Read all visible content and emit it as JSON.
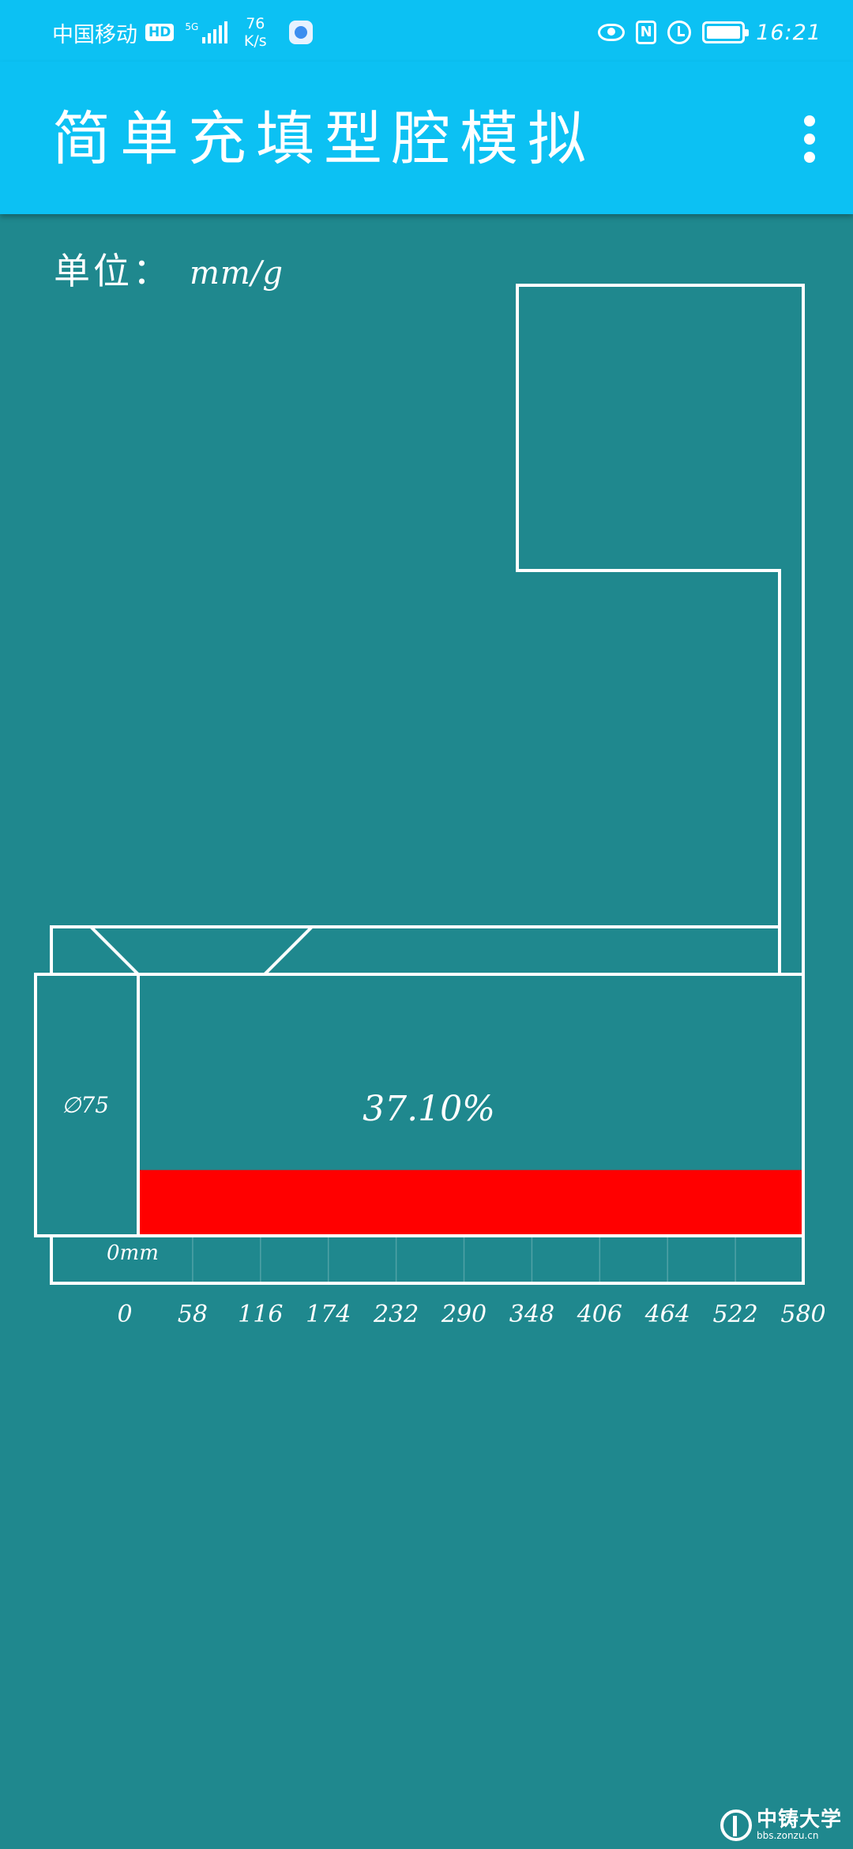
{
  "status_bar": {
    "carrier": "中国移动",
    "hd_badge": "HD",
    "network_type": "5G",
    "net_speed_value": "76",
    "net_speed_unit": "K/s",
    "time": "16:21",
    "nfc_label": "N",
    "icons": [
      "hd-icon",
      "signal-icon",
      "app-notification-icon",
      "eye-icon",
      "nfc-icon",
      "alarm-icon",
      "battery-icon"
    ]
  },
  "app_bar": {
    "title": "简单充填型腔模拟",
    "menu_icon": "overflow-menu-icon"
  },
  "unit": {
    "label": "单位：",
    "value": "mm/g"
  },
  "simulation": {
    "fill_percent_text": "37.10%",
    "fill_fraction": 0.371,
    "diameter_label": "∅75",
    "origin_label": "0mm",
    "scale_ticks": [
      "0",
      "58",
      "116",
      "174",
      "232",
      "290",
      "348",
      "406",
      "464",
      "522",
      "580"
    ],
    "fill_color": "#ff0000",
    "outline_color": "#ffffff",
    "background_color": "#1f888e"
  },
  "watermark": {
    "name": "中铸大学",
    "url": "bbs.zonzu.cn"
  },
  "colors": {
    "app_bar": "#0cc1f3",
    "background": "#1f888e",
    "fill": "#ff0000"
  }
}
